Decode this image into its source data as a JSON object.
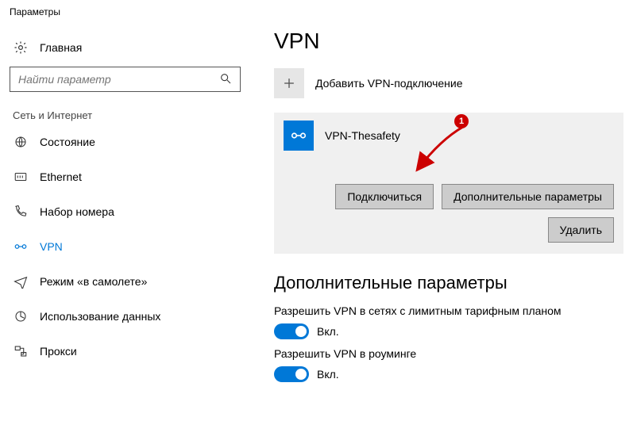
{
  "window": {
    "title": "Параметры"
  },
  "sidebar": {
    "home": "Главная",
    "search_placeholder": "Найти параметр",
    "category": "Сеть и Интернет",
    "items": [
      {
        "label": "Состояние"
      },
      {
        "label": "Ethernet"
      },
      {
        "label": "Набор номера"
      },
      {
        "label": "VPN"
      },
      {
        "label": "Режим «в самолете»"
      },
      {
        "label": "Использование данных"
      },
      {
        "label": "Прокси"
      }
    ]
  },
  "main": {
    "title": "VPN",
    "add_label": "Добавить VPN-подключение",
    "connection": {
      "name": "VPN-Thesafety",
      "connect": "Подключиться",
      "advanced": "Дополнительные параметры",
      "delete": "Удалить"
    },
    "advanced_section": "Дополнительные параметры",
    "toggle1_label": "Разрешить VPN в сетях с лимитным тарифным планом",
    "toggle1_state": "Вкл.",
    "toggle2_label": "Разрешить VPN в роуминге",
    "toggle2_state": "Вкл."
  },
  "annotation": {
    "step": "1"
  }
}
